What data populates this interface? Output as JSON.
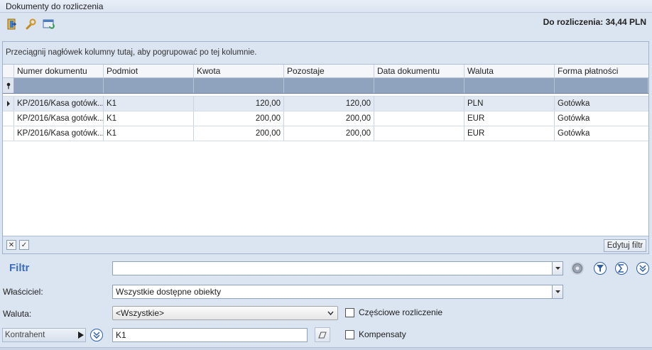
{
  "window": {
    "title": "Dokumenty do rozliczenia"
  },
  "toolbar": {
    "icons": [
      "export-icon",
      "wrench-icon",
      "refresh-list-icon"
    ]
  },
  "summary": {
    "to_settle": "Do rozliczenia: 34,44 PLN"
  },
  "grid": {
    "group_hint": "Przeciągnij nagłówek kolumny tutaj, aby pogrupować po tej kolumnie.",
    "columns": [
      "Numer dokumentu",
      "Podmiot",
      "Kwota",
      "Pozostaje",
      "Data dokumentu",
      "Waluta",
      "Forma płatności"
    ],
    "rows": [
      {
        "numer": "KP/2016/Kasa gotówk...",
        "podmiot": "K1",
        "kwota": "120,00",
        "pozostaje": "120,00",
        "data": "",
        "waluta": "PLN",
        "forma": "Gotówka"
      },
      {
        "numer": "KP/2016/Kasa gotówk...",
        "podmiot": "K1",
        "kwota": "200,00",
        "pozostaje": "200,00",
        "data": "",
        "waluta": "EUR",
        "forma": "Gotówka"
      },
      {
        "numer": "KP/2016/Kasa gotówk...",
        "podmiot": "K1",
        "kwota": "200,00",
        "pozostaje": "200,00",
        "data": "",
        "waluta": "EUR",
        "forma": "Gotówka"
      }
    ],
    "footer": {
      "edit_filter": "Edytuj filtr"
    }
  },
  "filter": {
    "label": "Filtr",
    "value": "",
    "owner_label": "Właściciel:",
    "owner_value": "Wszystkie dostępne obiekty",
    "currency_label": "Waluta:",
    "currency_value": "<Wszystkie>",
    "partial_label": "Częściowe rozliczenie",
    "partial_checked": false,
    "contractor_button": "Kontrahent",
    "contractor_value": "K1",
    "compensation_label": "Kompensaty",
    "compensation_checked": false
  },
  "colors": {
    "accent": "#3a6fbf",
    "background": "#dbe4f1",
    "filter_row": "#8fa3bf"
  }
}
